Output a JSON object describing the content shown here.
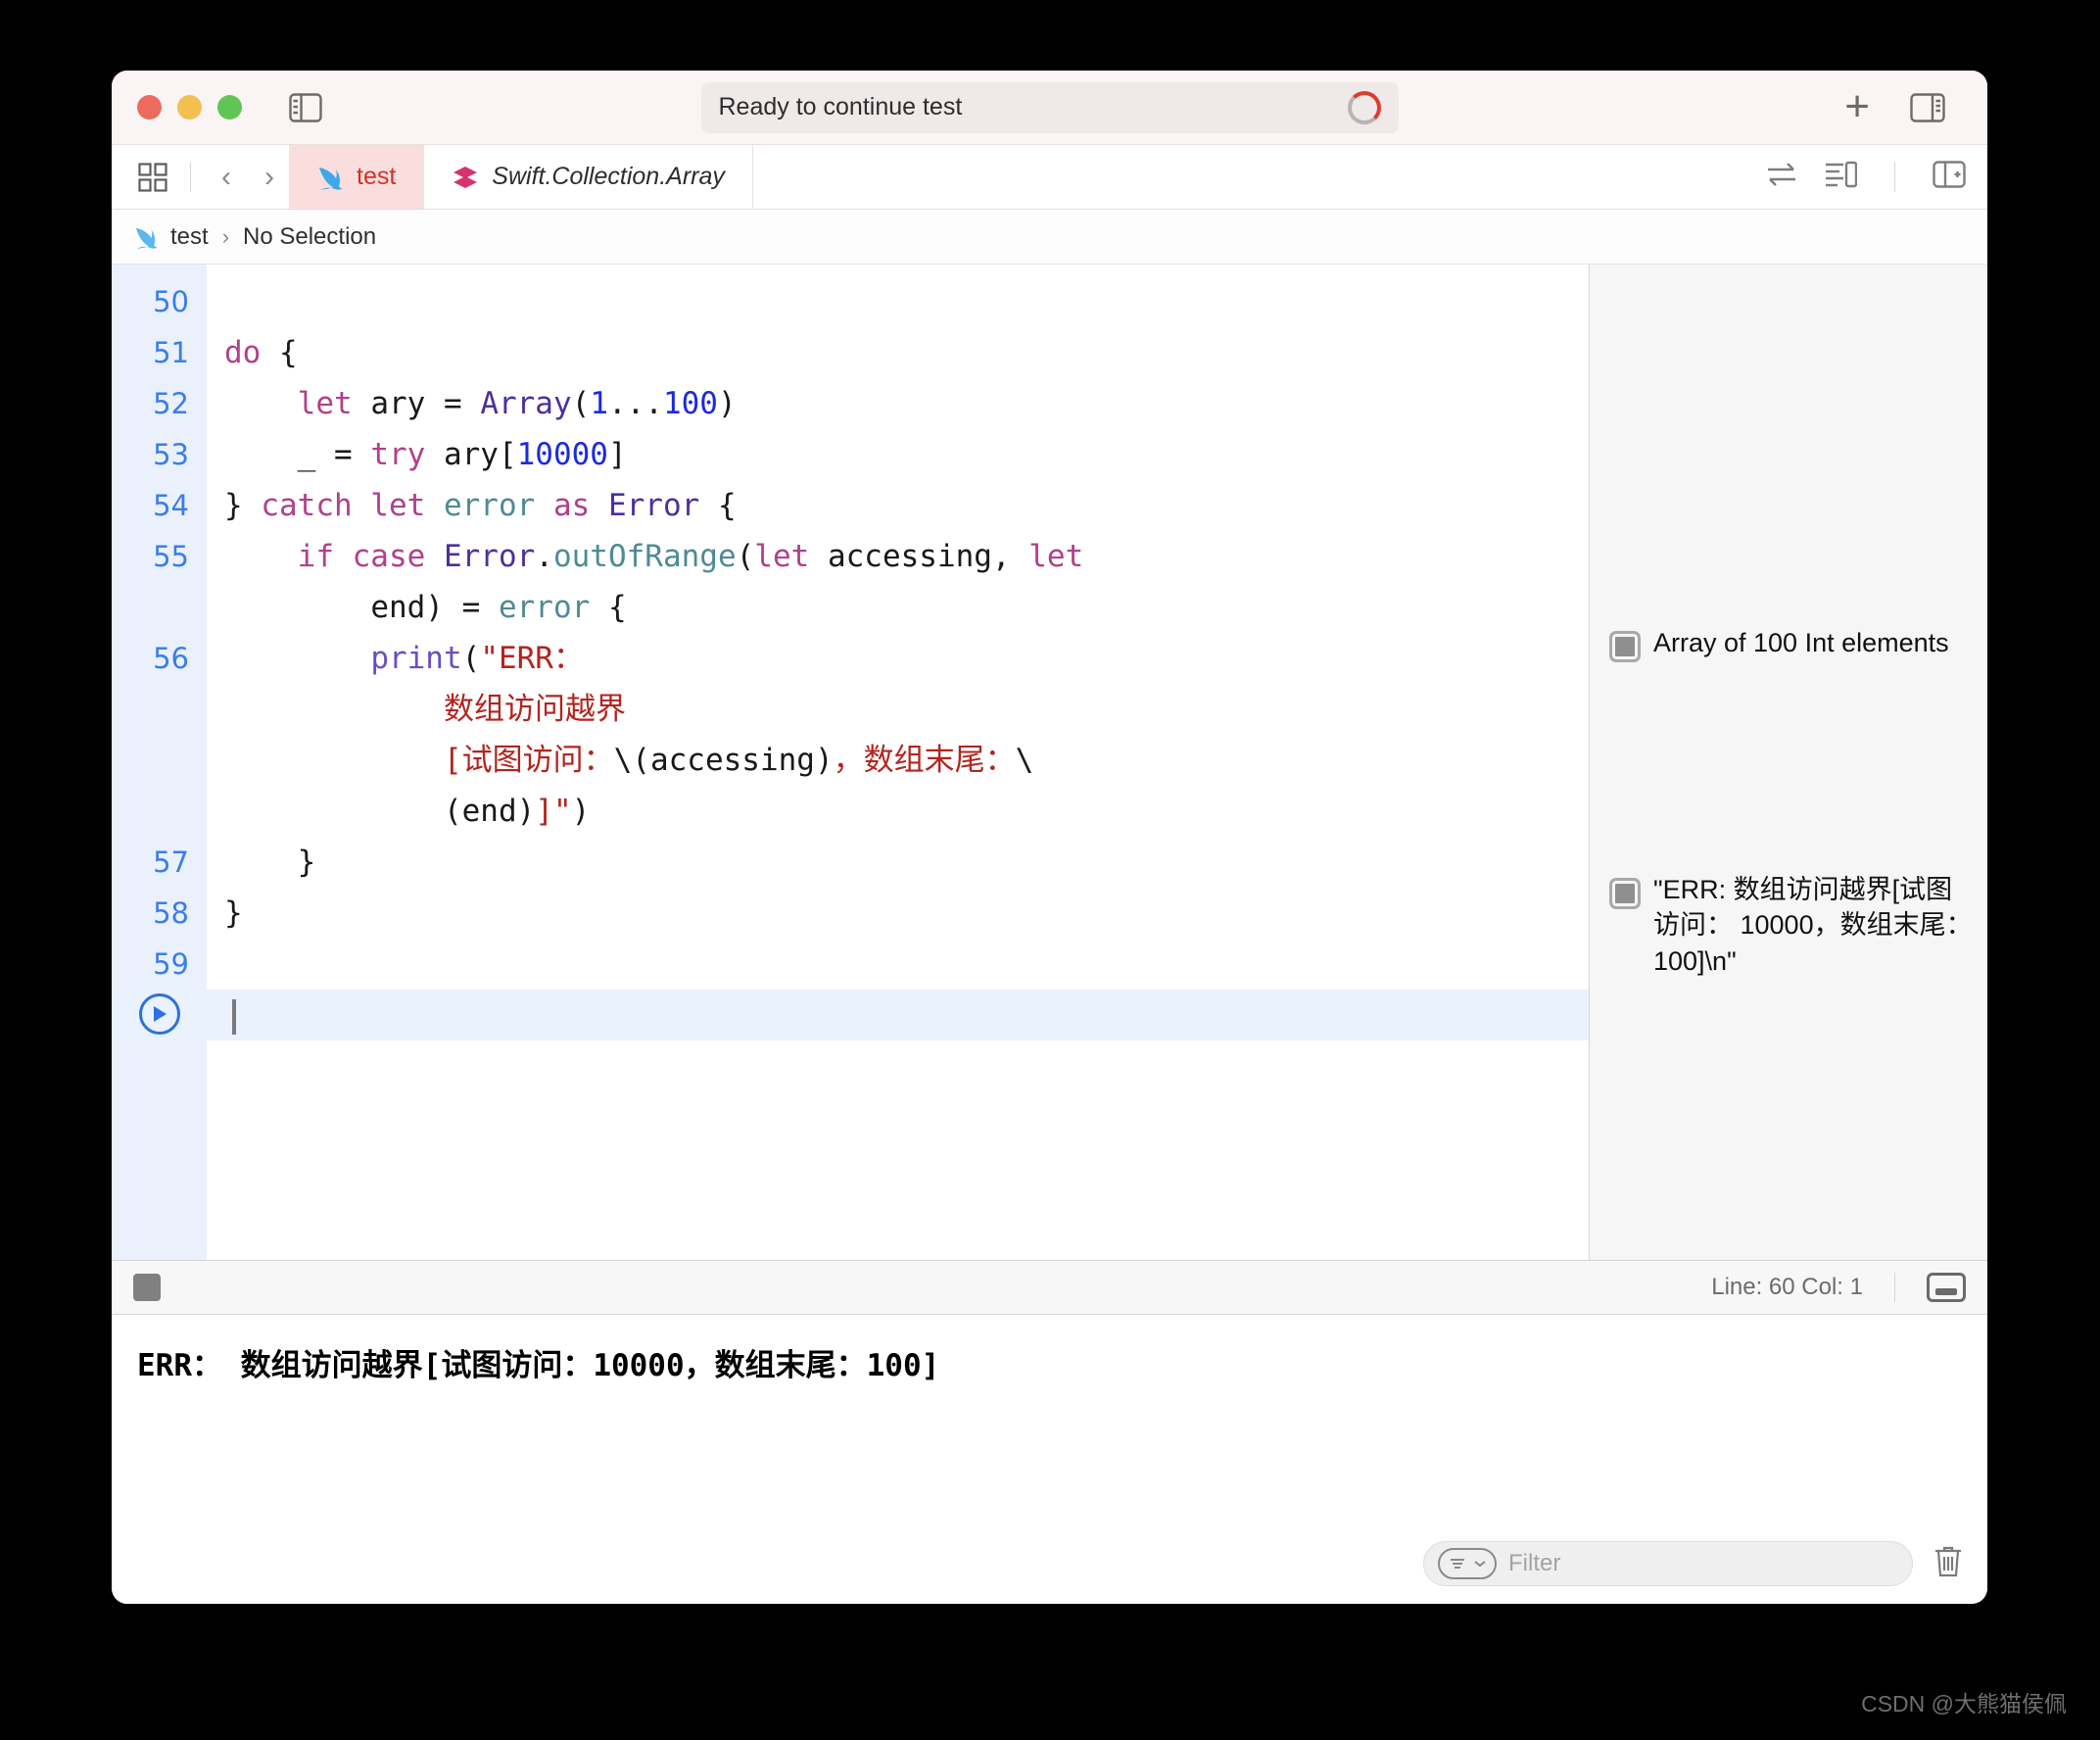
{
  "window": {
    "traffic_lights": [
      "close",
      "minimize",
      "zoom"
    ],
    "status": {
      "text": "Ready to continue test",
      "indicator": "progress-ring"
    },
    "toolbar_right": {
      "add_label": "+",
      "inspector_icon": "right-panel-icon"
    },
    "sidebar_toggle_icon": "left-panel-icon"
  },
  "tabs": {
    "nav_back": "‹",
    "nav_forward": "›",
    "grid_icon": "tab-grid-icon",
    "items": [
      {
        "label": "test",
        "icon": "swift-bird-icon",
        "active": true,
        "italic": false
      },
      {
        "label": "Swift.Collection.Array",
        "icon": "swift-module-icon",
        "active": false,
        "italic": true
      }
    ],
    "right_icons": [
      "swap-arrows-icon",
      "inspector-list-icon",
      "split-editor-icon"
    ]
  },
  "breadcrumb": {
    "icon": "swift-bird-icon",
    "project": "test",
    "separator": "›",
    "selection": "No Selection"
  },
  "editor": {
    "lines": [
      {
        "num": "50",
        "tokens": []
      },
      {
        "num": "51",
        "tokens": [
          {
            "t": "do",
            "c": "kw"
          },
          {
            "t": " {",
            "c": "pln"
          }
        ]
      },
      {
        "num": "52",
        "tokens": [
          {
            "t": "    ",
            "c": "pln"
          },
          {
            "t": "let",
            "c": "kw"
          },
          {
            "t": " ary = ",
            "c": "pln"
          },
          {
            "t": "Array",
            "c": "typ"
          },
          {
            "t": "(",
            "c": "pln"
          },
          {
            "t": "1",
            "c": "num"
          },
          {
            "t": "...",
            "c": "pln"
          },
          {
            "t": "100",
            "c": "num"
          },
          {
            "t": ")",
            "c": "pln"
          }
        ]
      },
      {
        "num": "53",
        "tokens": [
          {
            "t": "    _ = ",
            "c": "pln"
          },
          {
            "t": "try",
            "c": "kw"
          },
          {
            "t": " ary[",
            "c": "pln"
          },
          {
            "t": "10000",
            "c": "num"
          },
          {
            "t": "]",
            "c": "pln"
          }
        ]
      },
      {
        "num": "54",
        "tokens": [
          {
            "t": "} ",
            "c": "pln"
          },
          {
            "t": "catch let",
            "c": "kw"
          },
          {
            "t": " ",
            "c": "pln"
          },
          {
            "t": "error",
            "c": "var"
          },
          {
            "t": " ",
            "c": "pln"
          },
          {
            "t": "as",
            "c": "kw"
          },
          {
            "t": " ",
            "c": "pln"
          },
          {
            "t": "Error",
            "c": "typ"
          },
          {
            "t": " {",
            "c": "pln"
          }
        ]
      },
      {
        "num": "55",
        "tokens": [
          {
            "t": "    ",
            "c": "pln"
          },
          {
            "t": "if case",
            "c": "kw"
          },
          {
            "t": " ",
            "c": "pln"
          },
          {
            "t": "Error",
            "c": "typ"
          },
          {
            "t": ".",
            "c": "pln"
          },
          {
            "t": "outOfRange",
            "c": "var"
          },
          {
            "t": "(",
            "c": "pln"
          },
          {
            "t": "let",
            "c": "kw"
          },
          {
            "t": " accessing, ",
            "c": "pln"
          },
          {
            "t": "let",
            "c": "kw"
          },
          {
            "t": "\n        end) = ",
            "c": "pln"
          },
          {
            "t": "error",
            "c": "var"
          },
          {
            "t": " {",
            "c": "pln"
          }
        ]
      },
      {
        "num": "56",
        "tokens": [
          {
            "t": "        ",
            "c": "pln"
          },
          {
            "t": "print",
            "c": "fn"
          },
          {
            "t": "(",
            "c": "pln"
          },
          {
            "t": "\"ERR：\n            数组访问越界\n            [试图访问：",
            "c": "str"
          },
          {
            "t": "\\(accessing)",
            "c": "pln"
          },
          {
            "t": "，数组末尾：",
            "c": "str"
          },
          {
            "t": "\\\n            (end)",
            "c": "pln"
          },
          {
            "t": "]\"",
            "c": "str"
          },
          {
            "t": ")",
            "c": "pln"
          }
        ]
      },
      {
        "num": "57",
        "tokens": [
          {
            "t": "    }",
            "c": "pln"
          }
        ]
      },
      {
        "num": "58",
        "tokens": [
          {
            "t": "}",
            "c": "pln"
          }
        ]
      },
      {
        "num": "59",
        "tokens": []
      },
      {
        "num": "",
        "tokens": [],
        "current": true,
        "run_button": "run-line-icon"
      }
    ]
  },
  "results": [
    {
      "chip": "result-toggle-icon",
      "text": "Array of 100 Int elements"
    },
    {
      "chip": "result-toggle-icon",
      "text": "\"ERR: 数组访问越界[试图访问： 10000，数组末尾： 100]\\n\""
    }
  ],
  "statusbar": {
    "stop_icon": "stop-square-icon",
    "line_col": "Line: 60  Col: 1",
    "console_toggle_icon": "console-panel-icon"
  },
  "console": {
    "output": "ERR： 数组访问越界[试图访问：10000，数组末尾：100]",
    "filter_placeholder": "Filter",
    "filter_value": "",
    "filter_icon": "filter-dropdown-icon",
    "trash_icon": "trash-icon"
  },
  "watermark": "CSDN @大熊猫侯佩",
  "colors": {
    "accent_red": "#d4302a",
    "tab_active_bg": "#fadede",
    "line_number": "#3b7dec",
    "current_line_bg": "#eaf2fd",
    "string": "#b3241f",
    "keyword": "#b0418a",
    "type": "#4d2e9e",
    "variable": "#4e8b93",
    "number": "#1c2ae0"
  }
}
